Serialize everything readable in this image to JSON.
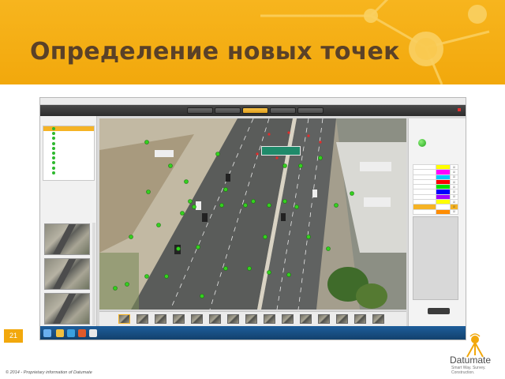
{
  "slide": {
    "title": "Определение новых точек",
    "page_number": "21",
    "copyright": "© 2014 - Proprietary information of Datumate"
  },
  "logo": {
    "name": "Datumate",
    "tagline": "Smart Way. Survey. Construction."
  },
  "colors": {
    "accent": "#f2a80c",
    "title_text": "#5a4128",
    "point_marker": "#2db82d",
    "selected_row": "#f5b325"
  },
  "app": {
    "toolbar_buttons": [
      "",
      "",
      "",
      "",
      "",
      ""
    ],
    "active_tab_index": 3,
    "point_list": {
      "items": [
        "",
        "",
        "",
        "",
        "",
        "",
        "",
        "",
        "",
        ""
      ],
      "selected_index": 0
    },
    "right_panel": {
      "colors": [
        "#ffff00",
        "#ff00ff",
        "#00c8ff",
        "#ff0000",
        "#00e000",
        "#0000ff",
        "#a000ff",
        "#ffff00",
        "#ffffff",
        "#ff8c00"
      ],
      "selected_index": 8
    },
    "filmstrip_frames": 15,
    "current_frame": 0,
    "status": "ok"
  },
  "icons": {
    "page_badge": "orange-square",
    "status": "green-circle-icon",
    "logo_mark": "datumate-tripod-icon"
  }
}
